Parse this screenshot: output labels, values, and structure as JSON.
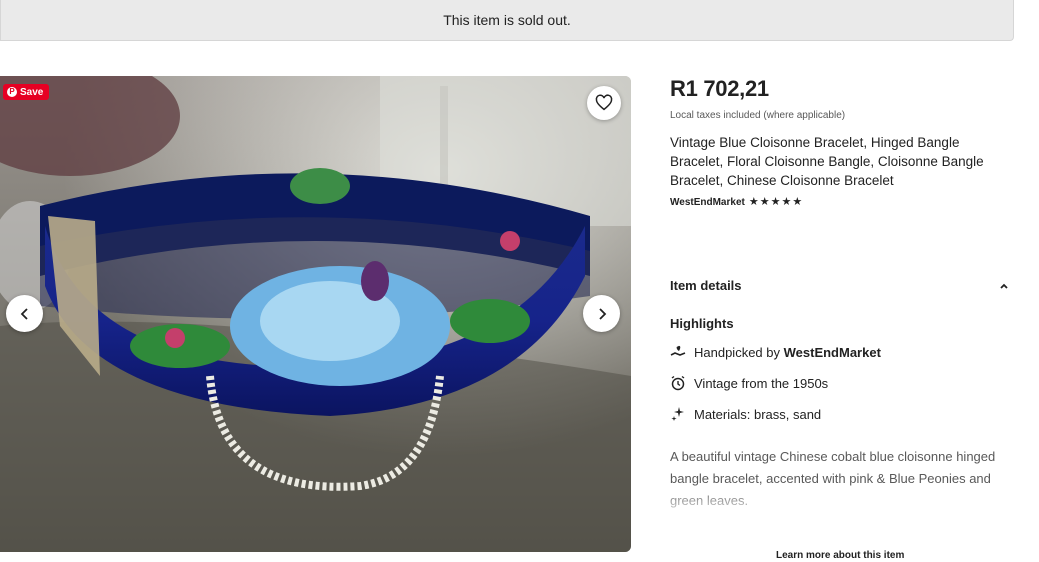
{
  "banner": {
    "text": "This item is sold out."
  },
  "gallery": {
    "save_label": "Save",
    "icons": {
      "pin": "pinterest-icon",
      "favorite": "heart-icon",
      "prev": "chevron-left-icon",
      "next": "chevron-right-icon"
    },
    "colors": {
      "pinterest": "#e60023"
    }
  },
  "listing": {
    "price": "R1 702,21",
    "tax_note": "Local taxes included (where applicable)",
    "title": "Vintage Blue Cloisonne Bracelet, Hinged Bangle Bracelet, Floral Cloisonne Bangle, Cloisonne Bangle Bracelet, Chinese Cloisonne Bracelet",
    "shop_name": "WestEndMarket",
    "rating_stars": 5
  },
  "item_details": {
    "header": "Item details",
    "highlights_title": "Highlights",
    "highlights": [
      {
        "icon": "hand-heart-icon",
        "prefix": "Handpicked by ",
        "bold": "WestEndMarket"
      },
      {
        "icon": "clock-icon",
        "prefix": "Vintage from the 1950s",
        "bold": ""
      },
      {
        "icon": "sparkle-icon",
        "prefix": "Materials: brass, sand",
        "bold": ""
      }
    ],
    "description": "A beautiful vintage Chinese cobalt blue cloisonne hinged bangle bracelet, accented with pink & Blue Peonies and green leaves.",
    "learn_more": "Learn more about this item"
  }
}
